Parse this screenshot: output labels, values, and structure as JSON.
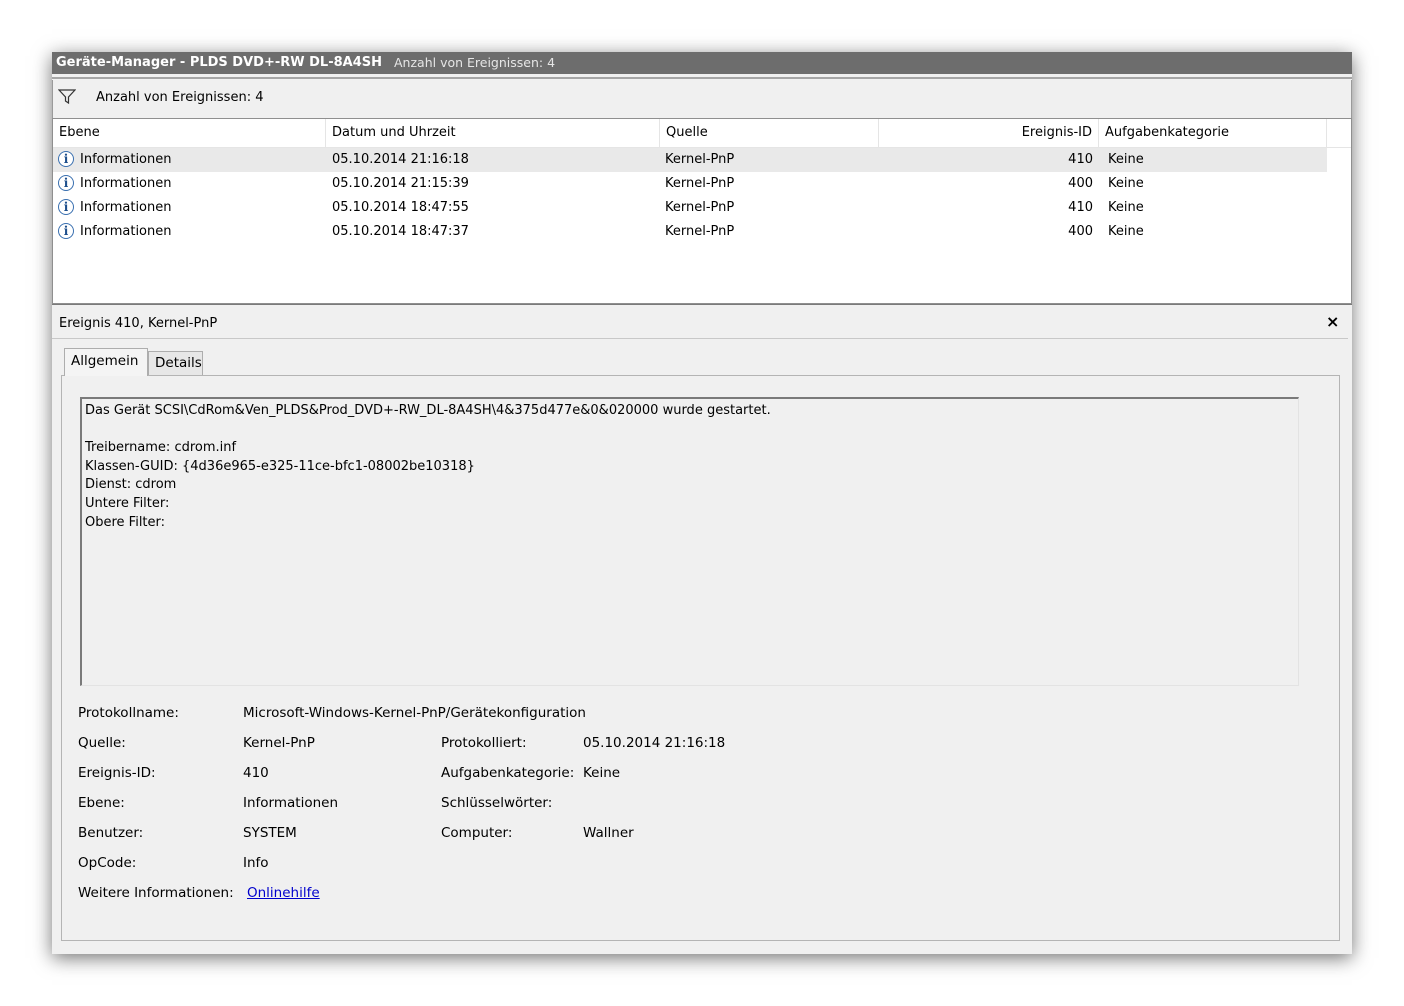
{
  "window": {
    "title": "Geräte-Manager - PLDS DVD+-RW DL-8A4SH",
    "title_suffix": "Anzahl von Ereignissen: 4"
  },
  "filter": {
    "icon": "filter-icon",
    "text": "Anzahl von Ereignissen: 4"
  },
  "list": {
    "columns": [
      "Ebene",
      "Datum und Uhrzeit",
      "Quelle",
      "Ereignis-ID",
      "Aufgabenkategorie"
    ],
    "rows": [
      {
        "level": "Informationen",
        "datetime": "05.10.2014 21:16:18",
        "source": "Kernel-PnP",
        "id": "410",
        "category": "Keine",
        "selected": true
      },
      {
        "level": "Informationen",
        "datetime": "05.10.2014 21:15:39",
        "source": "Kernel-PnP",
        "id": "400",
        "category": "Keine",
        "selected": false
      },
      {
        "level": "Informationen",
        "datetime": "05.10.2014 18:47:55",
        "source": "Kernel-PnP",
        "id": "410",
        "category": "Keine",
        "selected": false
      },
      {
        "level": "Informationen",
        "datetime": "05.10.2014 18:47:37",
        "source": "Kernel-PnP",
        "id": "400",
        "category": "Keine",
        "selected": false
      }
    ],
    "level_icon": "i"
  },
  "detail": {
    "title": "Ereignis 410, Kernel-PnP",
    "close": "×",
    "tabs": [
      "Allgemein",
      "Details"
    ],
    "message": "Das Gerät SCSI\\CdRom&Ven_PLDS&Prod_DVD+-RW_DL-8A4SH\\4&375d477e&0&020000 wurde gestartet.\n\nTreibername: cdrom.inf\nKlassen-GUID: {4d36e965-e325-11ce-bfc1-08002be10318}\nDienst: cdrom\nUntere Filter:\nObere Filter:",
    "props": {
      "log_label": "Protokollname:",
      "log_value": "Microsoft-Windows-Kernel-PnP/Gerätekonfiguration",
      "source_label": "Quelle:",
      "source_value": "Kernel-PnP",
      "logged_label": "Protokolliert:",
      "logged_value": "05.10.2014 21:16:18",
      "id_label": "Ereignis-ID:",
      "id_value": "410",
      "cat_label": "Aufgabenkategorie:",
      "cat_value": "Keine",
      "level_label": "Ebene:",
      "level_value": "Informationen",
      "kw_label": "Schlüsselwörter:",
      "kw_value": "",
      "user_label": "Benutzer:",
      "user_value": "SYSTEM",
      "comp_label": "Computer:",
      "comp_value": "Wallner",
      "op_label": "OpCode:",
      "op_value": "Info",
      "more_label": "Weitere Informationen:",
      "more_link": "Onlinehilfe"
    }
  }
}
